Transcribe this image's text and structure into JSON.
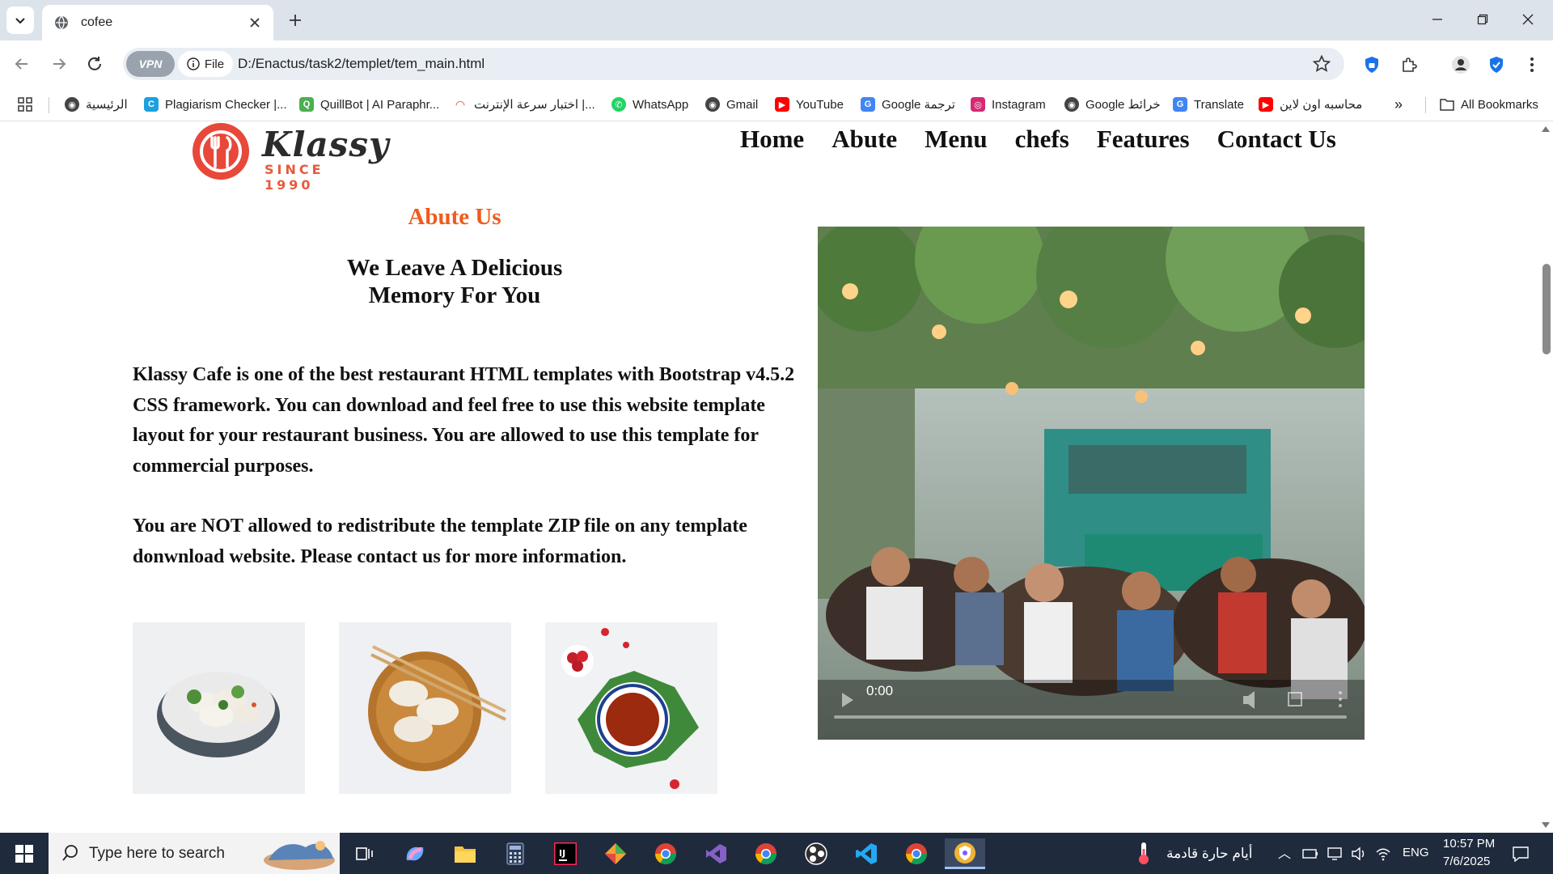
{
  "browser": {
    "tab_title": "cofee",
    "url_chip": "File",
    "vpn_label": "VPN",
    "url": "D:/Enactus/task2/templet/tem_main.html",
    "bookmarks": [
      {
        "label": "الرئيسية",
        "icon": "globe-icon"
      },
      {
        "label": "Plagiarism Checker |...",
        "icon": "plagiarism-checker-icon"
      },
      {
        "label": "QuillBot | AI Paraphr...",
        "icon": "quillbot-icon"
      },
      {
        "label": "اختبار سرعة الإنترنت |...",
        "icon": "speedtest-icon"
      },
      {
        "label": "WhatsApp",
        "icon": "whatsapp-icon"
      },
      {
        "label": "Gmail",
        "icon": "globe-icon"
      },
      {
        "label": "YouTube",
        "icon": "youtube-icon"
      },
      {
        "label": "Google ترجمة",
        "icon": "google-translate-icon"
      },
      {
        "label": "Instagram",
        "icon": "instagram-icon"
      },
      {
        "label": "Google خرائط",
        "icon": "globe-icon"
      },
      {
        "label": "Translate",
        "icon": "google-translate-icon"
      },
      {
        "label": "محاسبه اون لاين",
        "icon": "youtube-icon"
      }
    ],
    "all_bookmarks": "All Bookmarks"
  },
  "site": {
    "logo_text": "Klassy",
    "logo_sub": "SINCE 1990",
    "nav": [
      "Home",
      "Abute",
      "Menu",
      "chefs",
      "Features",
      "Contact Us"
    ],
    "about_label": "Abute Us",
    "heading_line1": "We Leave A Delicious",
    "heading_line2": "Memory For You",
    "para1": "Klassy Cafe is one of the best restaurant HTML templates with Bootstrap v4.5.2 CSS framework. You can download and feel free to use this website template layout for your restaurant business. You are allowed to use this template for commercial purposes.",
    "para2": "You are NOT allowed to redistribute the template ZIP file on any template donwnload website. Please contact us for more information.",
    "video_time": "0:00"
  },
  "taskbar": {
    "search_placeholder": "Type here to search",
    "weather": "أيام حارة قادمة",
    "lang": "ENG",
    "time": "10:57 PM",
    "date": "7/6/2025"
  },
  "colors": {
    "accent": "#f05a1a",
    "logo_red": "#e85a3b",
    "taskbar": "#1f2a3d"
  }
}
